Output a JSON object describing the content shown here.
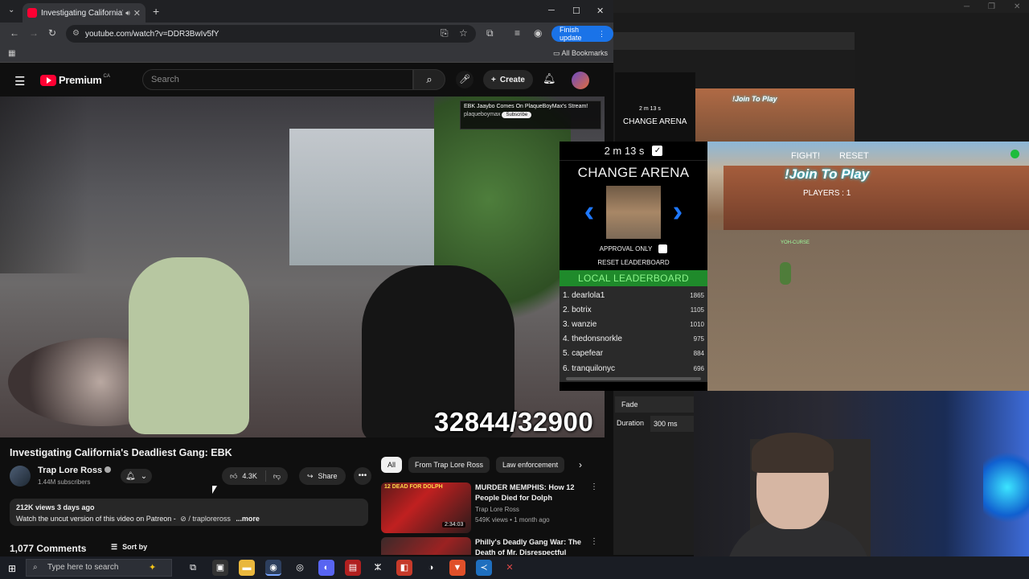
{
  "browser": {
    "tab_title": "Investigating California's De",
    "url": "youtube.com/watch?v=DDR3BwIv5fY",
    "finish_update": "Finish update",
    "all_bookmarks": "All Bookmarks"
  },
  "youtube": {
    "logo_text": "Premium",
    "country": "CA",
    "search_placeholder": "Search",
    "create_label": "Create"
  },
  "video": {
    "overlay_banner": "EBK Jaaybo Comes On PlaqueBoyMax's Stream!",
    "overlay_channel": "plaqueboymax",
    "overlay_subscribe": "Subscribe",
    "counter": "32844/32900",
    "title": "Investigating California's Deadliest Gang: EBK",
    "channel": "Trap Lore Ross",
    "subscribers": "1.44M subscribers",
    "likes": "4.3K",
    "share": "Share",
    "views_date": "212K views  3 days ago",
    "description": "Watch the uncut version of this video on Patreon -",
    "patreon_handle": "/ traploreross",
    "more": "...more",
    "comments": "1,077 Comments",
    "sort_by": "Sort by"
  },
  "chips": [
    "All",
    "From Trap Lore Ross",
    "Law enforcement"
  ],
  "related": [
    {
      "thumb_caption": "12 DEAD FOR DOLPH",
      "duration": "2:34:03",
      "title": "MURDER MEMPHIS: How 12 People Died for Dolph",
      "channel": "Trap Lore Ross",
      "meta": "549K views • 1 month ago"
    },
    {
      "thumb_caption": "",
      "duration": "",
      "title": "Philly's Deadly Gang War: The Death of Mr. Disrespectful",
      "channel": "",
      "meta": ""
    }
  ],
  "game": {
    "timer": "2 m 13 s",
    "change_arena": "CHANGE ARENA",
    "approval_only": "APPROVAL ONLY",
    "reset_leaderboard": "RESET LEADERBOARD",
    "local_leaderboard": "LOCAL LEADERBOARD",
    "leaderboard": [
      {
        "rank": "1.",
        "name": "dearlola1",
        "score": "1865"
      },
      {
        "rank": "2.",
        "name": "botrix",
        "score": "1105"
      },
      {
        "rank": "3.",
        "name": "wanzie",
        "score": "1010"
      },
      {
        "rank": "4.",
        "name": "thedonsnorkle",
        "score": "975"
      },
      {
        "rank": "5.",
        "name": "capefear",
        "score": "884"
      },
      {
        "rank": "6.",
        "name": "tranquilonyc",
        "score": "696"
      }
    ],
    "fight": "FIGHT!",
    "reset": "RESET",
    "join": "!Join To Play",
    "players": "PLAYERS : 1",
    "player_tag": "YOH-CURSE"
  },
  "mini": {
    "change_arena": "CHANGE ARENA",
    "timer": "2 m 13 s",
    "join": "!Join To Play"
  },
  "transition": {
    "fade": "Fade",
    "duration_label": "Duration",
    "duration_value": "300 ms"
  },
  "taskbar": {
    "search_placeholder": "Type here to search"
  },
  "colors": {
    "youtube_red": "#ff0033",
    "leaderboard_green": "#1f8a2b",
    "arrow_blue": "#1e78ff",
    "finish_blue": "#1a73e8"
  }
}
